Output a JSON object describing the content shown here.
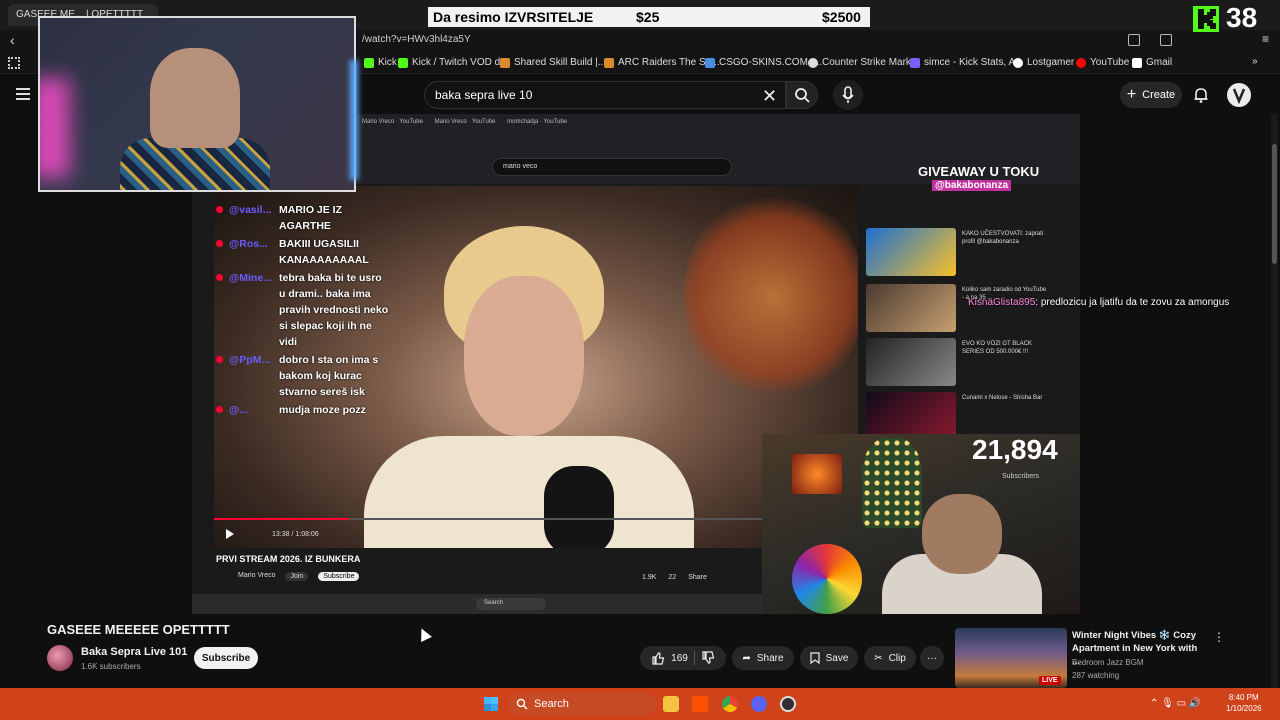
{
  "browser": {
    "tab_title": "GASEEE ME... | OPETTTTT",
    "url": "/watch?v=HWv3hl4za5Y",
    "bookmarks": [
      {
        "label": "Kick",
        "color": "#53fc18"
      },
      {
        "label": "Kick / Twitch VOD d...",
        "color": "#53fc18"
      },
      {
        "label": "Shared Skill Build |...",
        "color": "#d98a2b"
      },
      {
        "label": "ARC Raiders The Sp...",
        "color": "#d98a2b"
      },
      {
        "label": "CSGO-SKINS.COM -...",
        "color": "#4a90e2"
      },
      {
        "label": "Counter Strike Mark...",
        "color": "#dddddd"
      },
      {
        "label": "simce - Kick Stats, A...",
        "color": "#7a5cff"
      },
      {
        "label": "Lostgamer",
        "color": "#ffffff"
      },
      {
        "label": "YouTube",
        "color": "#ff0000"
      },
      {
        "label": "Gmail",
        "color": "#ffffff"
      }
    ]
  },
  "overlay": {
    "banner_text": "Da resimo IZVRSITELJE",
    "banner_price_low": "$25",
    "banner_price_high": "$2500",
    "kick_count": "38"
  },
  "header": {
    "search_value": "baka sepra live 10",
    "create_label": "Create"
  },
  "player": {
    "inner_search": "mario veco",
    "inner_time": "13:38 / 1:08:06",
    "inner_progress": 0.21,
    "chat": [
      {
        "user": "@vasil...",
        "text": "MARIO JE IZ AGARTHE"
      },
      {
        "user": "@Ros...",
        "text": "BAKIII UGASILII KANAAAAAAAAL"
      },
      {
        "user": "@Mine...",
        "text": "tebra baka bi te usro u drami.. baka ima pravih vrednosti neko si slepac koji ih ne vidi"
      },
      {
        "user": "@PpM...",
        "text": "dobro I sta on ima s bakom koj kurac stvarno sereš isk"
      },
      {
        "user": "@...",
        "text": "mudja moze pozz"
      }
    ],
    "inner_title": "PRVI STREAM 2026. IZ BUNKERA",
    "inner_channel": "Mario Vreco",
    "inner_join": "Join",
    "inner_subscribe": "Subscribe",
    "inner_likes": "1.9K",
    "inner_dislikes": "22",
    "inner_share": "Share",
    "inner_taskbar_search": "Search",
    "giveaway_title": "GIVEAWAY U TOKU",
    "giveaway_handle": "@bakabonanza",
    "side_videos": [
      {
        "title": "KAKO UČESTVOVATI: zaprati profil @bakabonanza",
        "meta": "LIVE"
      },
      {
        "title": "Koliko sam zaradio od YouTube - a na 35 ...",
        "meta": "Vladimir Stevanovic"
      },
      {
        "title": "EVO KO VOZI GT BLACK SERIES OD 500.000€ !!!",
        "meta": "PetrolHeads Auto Vlog"
      },
      {
        "title": "Cunami x Nelose - Shisha Bar",
        "meta": "Cunami Pb"
      }
    ],
    "sub_count": "21,894",
    "sub_label": "Subscribers",
    "floating_chat_user": "KisnaGlista895",
    "floating_chat_text": ": predlozicu ja ljatifu da te zovu za amongus"
  },
  "video": {
    "title": "GASEEE MEEEEE OPETTTTT",
    "channel_name": "Baka Sepra Live 101",
    "channel_subs": "1.6K subscribers",
    "subscribe_label": "Subscribe",
    "like_count": "169",
    "share_label": "Share",
    "save_label": "Save",
    "clip_label": "Clip"
  },
  "recommended": {
    "title": "Winter Night Vibes ❄️ Cozy Apartment in New York with ...",
    "channel": "Bedroom Jazz BGM",
    "watching": "287 watching",
    "live_badge": "LIVE"
  },
  "taskbar": {
    "search_label": "Search",
    "time": "8:40 PM",
    "date": "1/10/2026"
  }
}
